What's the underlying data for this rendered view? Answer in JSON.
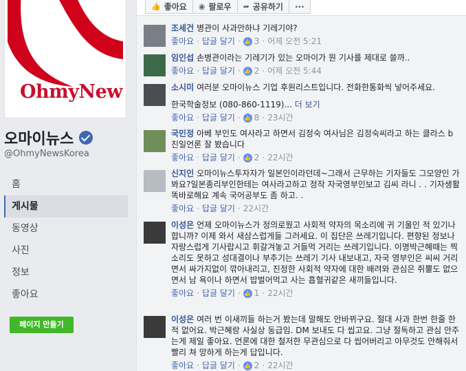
{
  "sidebar": {
    "page_name": "오마이뉴스",
    "handle": "@OhmyNewsKorea",
    "logo_text": "OhmyNews",
    "nav": [
      "홈",
      "게시물",
      "동영상",
      "사진",
      "정보",
      "좋아요"
    ],
    "active_nav": "게시물",
    "create_page": "페이지 만들기"
  },
  "actions": {
    "like": "좋아요",
    "follow": "팔로우",
    "share": "공유하기",
    "more": "···"
  },
  "comment_actions": {
    "like": "좋아요",
    "reply": "답글 달기"
  },
  "comments": [
    {
      "author": "조세건",
      "text": "병관이 사과안하냐 기레기야?",
      "likes": "3",
      "time": "어제 오전 5:21"
    },
    {
      "author": "임인섭",
      "text": "손병관이라는 기레기가 있는 오마이가 뭔 기사를 제대로 쓸까..",
      "likes": "2",
      "time": "어제 오전 5:44"
    },
    {
      "author": "소시미",
      "text": "여러분 오마이뉴스 기업 후원리스트입니다. 전화한통화씩 넣어주세요.",
      "extra": "한국학술정보 (080-860-1119)...",
      "more": "더 보기",
      "likes": "8",
      "time": "23시간"
    },
    {
      "author": "국민정",
      "text": "아베 부인도 여사라고 하면서 김정숙 여사님은 김정숙씨라고 하는 클라스 b 친일언론 잘 봤습니다",
      "likes": "2",
      "time": "22시간"
    },
    {
      "author": "신지인",
      "text": "오마이뉴스투자자가 일본인이라던데~그래서 근무하는 기자들도 그모양인 가봐요?일본종리부인한테는 여사라고하고 정작 자국영부인보고 김씨 라니 . . 기자생활똑바로해요 계속 국어공부도 좀 하고. .",
      "likes": "",
      "time": "22시간"
    },
    {
      "author": "이성은",
      "text": "언제 오마이뉴스가 정의로웠고 사회적 약자의 목소리에 귀 기울인 적 있기나 합니까? 이제 와서 새삼스럽게들 그러세요. 이 집단은 쓰레기입니다. 편향된 정보나 자랑스럽게 기사랍시고 휘갈겨놓고 거들먹 거리는 쓰레기입니다. 이명박근혜때는 찍소리도 못하고 성대결이나 부추기는 쓰레기 기사 내보내고, 자국 영부인은 씨씨 거리면서 싸가지없이 깎아내리고, 진정한 사회적 약자에 대한 배려와 관심은 쥐뿔도 없으면서 남 욕이나 하면서 밥벌어먹고 사는 흡혈귀같은 새끼들입니다.",
      "likes": "1",
      "time": "22시간"
    },
    {
      "author": "이성은",
      "text": "여러 번 이새끼들 하는거 봤는데 말해도 안바뀌구요. 절대 사과 한번 한줄 한 적 없어요. 박근혜랑 사실상 동급임. DM 보내도 다 씹고요. 그냥 절독하고 관심 안주는게 제일 좋아요. 언론에 대한 철저한 무관심으로 다 씹어버리고 아무것도 안해줘서 빨리 쳐 망하게 하는게 답입니다.",
      "likes": "2",
      "time": "22시간"
    }
  ],
  "colors": {
    "brand_red": "#c8102e",
    "link": "#365899",
    "create_btn": "#42b72a",
    "verified": "#4267b2"
  }
}
